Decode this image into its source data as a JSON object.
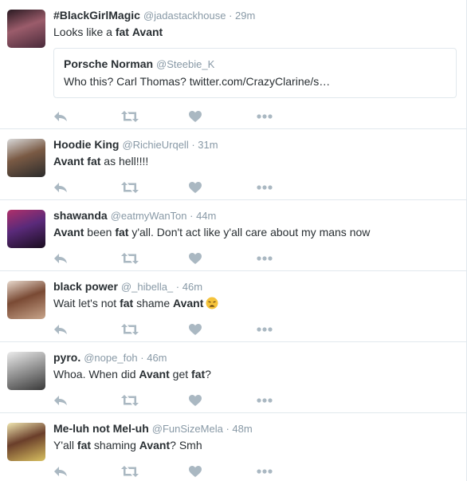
{
  "tweets": [
    {
      "name": "#BlackGirlMagic",
      "handle": "@jadastackhouse",
      "time": "29m",
      "text": [
        {
          "t": "Looks like a ",
          "b": false
        },
        {
          "t": "fat",
          "b": true
        },
        {
          "t": " ",
          "b": false
        },
        {
          "t": "Avant",
          "b": true
        }
      ],
      "quote": {
        "name": "Porsche Norman",
        "handle": "@Steebie_K",
        "text": "Who this? Carl Thomas? twitter.com/CrazyClarine/s…"
      },
      "avatar_colors": [
        "#4a2a3a",
        "#9b5c6b",
        "#2a1a22"
      ]
    },
    {
      "name": "Hoodie King",
      "handle": "@RichieUrqell",
      "time": "31m",
      "text": [
        {
          "t": "Avant",
          "b": true
        },
        {
          "t": " ",
          "b": false
        },
        {
          "t": "fat",
          "b": true
        },
        {
          "t": " as hell!!!!",
          "b": false
        }
      ],
      "avatar_colors": [
        "#2b2b2b",
        "#7a5a44",
        "#d9d9d9"
      ]
    },
    {
      "name": "shawanda",
      "handle": "@eatmyWanTon",
      "time": "44m",
      "text": [
        {
          "t": "Avant",
          "b": true
        },
        {
          "t": " been ",
          "b": false
        },
        {
          "t": "fat",
          "b": true
        },
        {
          "t": " y'all. Don't act like y'all care about my mans now",
          "b": false
        }
      ],
      "avatar_colors": [
        "#1a0d1f",
        "#5a2a7a",
        "#b0306a"
      ]
    },
    {
      "name": "black power",
      "handle": "@_hibella_",
      "time": "46m",
      "text": [
        {
          "t": "Wait let's not ",
          "b": false
        },
        {
          "t": "fat",
          "b": true
        },
        {
          "t": " shame ",
          "b": false
        },
        {
          "t": "Avant",
          "b": true
        }
      ],
      "emoji": "weary-face",
      "avatar_colors": [
        "#c7a48a",
        "#7a4a34",
        "#e8d8cc"
      ]
    },
    {
      "name": "pyro.",
      "handle": "@nope_foh",
      "time": "46m",
      "text": [
        {
          "t": "Whoa. When did ",
          "b": false
        },
        {
          "t": "Avant",
          "b": true
        },
        {
          "t": " get ",
          "b": false
        },
        {
          "t": "fat",
          "b": true
        },
        {
          "t": "?",
          "b": false
        }
      ],
      "avatar_colors": [
        "#3a3a3a",
        "#9a9a9a",
        "#ececec"
      ]
    },
    {
      "name": "Me-luh not Mel-uh",
      "handle": "@FunSizeMela",
      "time": "48m",
      "text": [
        {
          "t": "Y'all ",
          "b": false
        },
        {
          "t": "fat",
          "b": true
        },
        {
          "t": " shaming ",
          "b": false
        },
        {
          "t": "Avant",
          "b": true
        },
        {
          "t": "? Smh",
          "b": false
        }
      ],
      "avatar_colors": [
        "#d8c060",
        "#6a3e2a",
        "#f0e6b0"
      ]
    }
  ],
  "colors": {
    "name": "#292f33",
    "meta": "#8899a6",
    "icon": "#aab8c2",
    "border": "#e1e8ed"
  },
  "icons": [
    "reply-icon",
    "retweet-icon",
    "like-heart-icon",
    "more-dots-icon"
  ]
}
